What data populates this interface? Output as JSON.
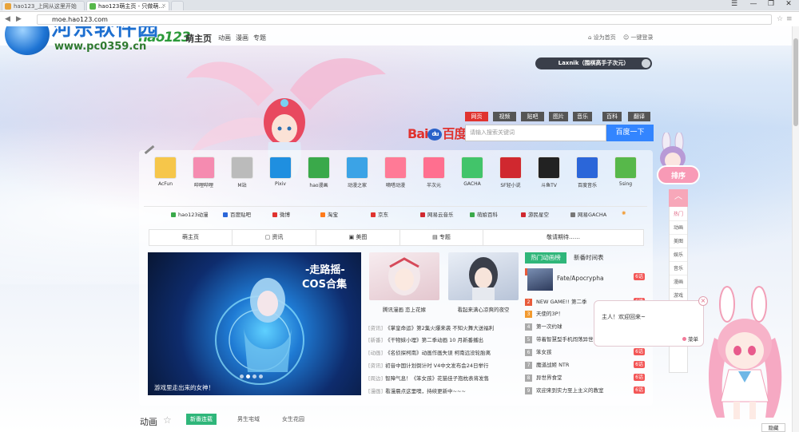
{
  "browser": {
    "tabs": [
      {
        "label": "hao123_上网从这里开始",
        "active": false
      },
      {
        "label": "hao123萌主页 - 只做萌…",
        "active": true
      }
    ],
    "url": "moe.hao123.com",
    "window_controls": [
      "☰",
      "—",
      "❐",
      "✕"
    ]
  },
  "watermark": {
    "title": "河东软件园",
    "url": "www.pc0359.cn"
  },
  "header": {
    "logo": "hao123",
    "logo_sub": "萌主页",
    "nav": [
      "动画",
      "漫画",
      "专题"
    ],
    "right_links": [
      "设为首页",
      "一键登录"
    ]
  },
  "player": {
    "track": "Laxnik（围棋高手子次元）"
  },
  "search": {
    "tabs": [
      "网页",
      "视频",
      "贴吧",
      "图片",
      "音乐",
      "百科",
      "翻译"
    ],
    "active_tab": "网页",
    "brand": "Bai",
    "brand_du": "du",
    "brand_cn": "百度",
    "placeholder": "请输入搜索关键词",
    "button": "百度一下"
  },
  "apps": [
    {
      "label": "AcFun",
      "color": "#f6c64a"
    },
    {
      "label": "哔哩哔哩",
      "color": "#f58bb0"
    },
    {
      "label": "M站",
      "color": "#bbbbbb"
    },
    {
      "label": "Pixiv",
      "color": "#1f8fe0"
    },
    {
      "label": "hao漫画",
      "color": "#3aa94a"
    },
    {
      "label": "动漫之家",
      "color": "#3ba3e6"
    },
    {
      "label": "嘀嗒动漫",
      "color": "#ff7a96"
    },
    {
      "label": "半次元",
      "color": "#ff6f8f"
    },
    {
      "label": "GACHA",
      "color": "#42c46a"
    },
    {
      "label": "SF轻小说",
      "color": "#d0282f"
    },
    {
      "label": "斗鱼TV",
      "color": "#222222"
    },
    {
      "label": "百度音乐",
      "color": "#2b66d9"
    },
    {
      "label": "5sing",
      "color": "#57b84a"
    }
  ],
  "links": [
    {
      "label": "hao123动漫",
      "color": "#3aa94a"
    },
    {
      "label": "百度贴吧",
      "color": "#2b66d9"
    },
    {
      "label": "微博",
      "color": "#e0332f"
    },
    {
      "label": "淘宝",
      "color": "#ff7a1a"
    },
    {
      "label": "京东",
      "color": "#e0332f"
    },
    {
      "label": "网易云音乐",
      "color": "#d0282f"
    },
    {
      "label": "萌娘百科",
      "color": "#3aa94a"
    },
    {
      "label": "游民星空",
      "color": "#d0282f"
    },
    {
      "label": "网易GACHA",
      "color": "#777777"
    }
  ],
  "sections_nav": [
    "萌主页",
    "资讯",
    "美图",
    "专题",
    "敬请期待……"
  ],
  "banner": {
    "line1": "-走路摇-",
    "line2": "COS合集",
    "caption": "游戏里走出来的女神！"
  },
  "thumbs": [
    {
      "caption": "腾讯漫画 恋上花嫁"
    },
    {
      "caption": "看起来满心凉爽的夜空"
    }
  ],
  "news": [
    {
      "tag": "[资讯]",
      "text": "《掌皇命运》第2集火爆来袭 不知火舞大送福利"
    },
    {
      "tag": "[新番]",
      "text": "《干物妹小埋》第二季动画 10 月新番播出"
    },
    {
      "tag": "[动画]",
      "text": "《名侦探柯南》动画作画失误 柯南远没轮胎离"
    },
    {
      "tag": "[资讯]",
      "text": "初音中国计划倒计时 V4中文发布会24日举行"
    },
    {
      "tag": "[周边]",
      "text": "智障气息！《笨女孩》花猫佳子抱枕表将发售"
    },
    {
      "tag": "[漫画]",
      "text": "看漫晨点这里噢，持续更新中~~~"
    }
  ],
  "hot": {
    "tab_active": "热门动画榜",
    "tab_other": "新番时间表",
    "feature": {
      "rank": "1",
      "title": "Fate/Apocrypha",
      "count": "6话"
    },
    "rows": [
      {
        "rank": "2",
        "title": "NEW GAME!! 第二季",
        "count": "6话"
      },
      {
        "rank": "3",
        "title": "天使的3P！",
        "count": "6话"
      },
      {
        "rank": "4",
        "title": "第一次约球",
        "count": "6话"
      },
      {
        "rank": "5",
        "title": "带着智慧型手机闯荡异世界",
        "count": "6话"
      },
      {
        "rank": "6",
        "title": "笨女孩",
        "count": "6话"
      },
      {
        "rank": "7",
        "title": "魔道战姬 NTR",
        "count": "6话"
      },
      {
        "rank": "8",
        "title": "异世界食堂",
        "count": "6话"
      },
      {
        "rank": "9",
        "title": "欢迎来到实力至上主义的教室",
        "count": "6话"
      }
    ]
  },
  "section_bottom": {
    "title": "动画",
    "tabs": [
      "新番连载",
      "男生宅域",
      "女生花园"
    ]
  },
  "sidebar": {
    "badge": "排序",
    "items": [
      "热门",
      "动画",
      "美图",
      "娱乐",
      "音乐",
      "漫画",
      "游戏"
    ]
  },
  "mascot": {
    "message": "主人！欢迎回来~",
    "menu": "菜单",
    "hide": "隐藏"
  }
}
